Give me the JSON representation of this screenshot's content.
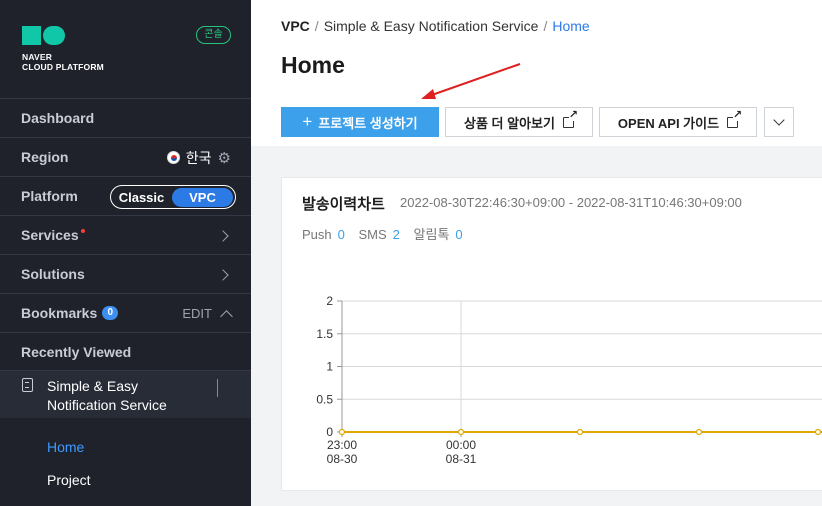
{
  "sidebar": {
    "logo_line1": "NAVER",
    "logo_line2": "CLOUD PLATFORM",
    "console_badge": "콘솔",
    "dashboard": "Dashboard",
    "region": {
      "label": "Region",
      "value": "한국"
    },
    "platform": {
      "label": "Platform",
      "options": [
        "Classic",
        "VPC"
      ],
      "selected": "VPC"
    },
    "services": "Services",
    "solutions": "Solutions",
    "bookmarks": {
      "label": "Bookmarks",
      "count": "0",
      "edit": "EDIT"
    },
    "recently_viewed": "Recently Viewed",
    "active_service": {
      "line1": "Simple & Easy",
      "line2": "Notification Service"
    },
    "sub_items": [
      "Home",
      "Project"
    ],
    "accent_color": "#3d9bff"
  },
  "breadcrumb": {
    "root": "VPC",
    "service": "Simple & Easy Notification Service",
    "current": "Home"
  },
  "page_title": "Home",
  "toolbar": {
    "create_project": "프로젝트 생성하기",
    "learn_more": "상품 더 알아보기",
    "api_guide": "OPEN API 가이드"
  },
  "card": {
    "title": "발송이력차트",
    "range": "2022-08-30T22:46:30+09:00 - 2022-08-31T10:46:30+09:00",
    "legend": [
      {
        "label": "Push",
        "value": "0"
      },
      {
        "label": "SMS",
        "value": "2"
      },
      {
        "label": "알림톡",
        "value": "0"
      }
    ]
  },
  "chart_data": {
    "type": "line",
    "y_ticks": [
      "2",
      "1.5",
      "1",
      "0.5",
      "0"
    ],
    "x_ticks": [
      {
        "time": "23:00",
        "date": "08-30"
      },
      {
        "time": "00:00",
        "date": "08-31"
      }
    ],
    "ylim": [
      0,
      2
    ],
    "grid": true,
    "series": [
      {
        "values": [
          0,
          0,
          0,
          0,
          0,
          0
        ],
        "color": "#e0a800"
      }
    ]
  }
}
